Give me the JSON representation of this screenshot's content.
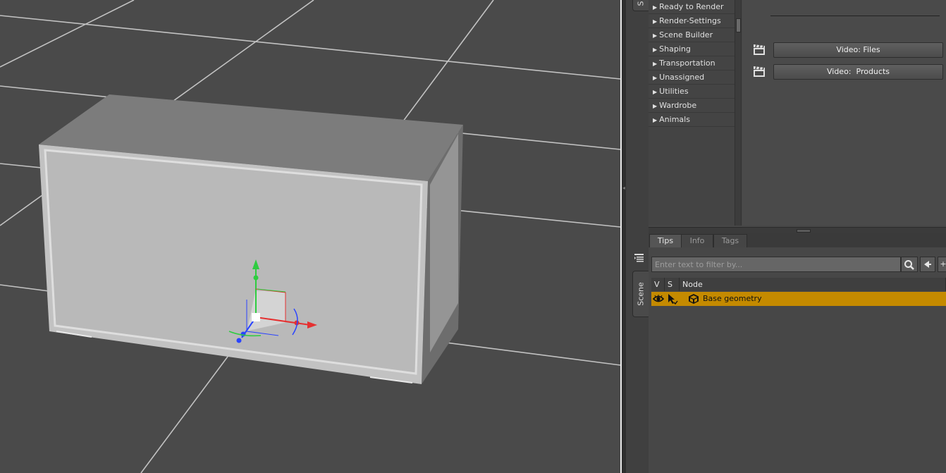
{
  "category_list": {
    "items": [
      "Ready to Render",
      "Render-Settings",
      "Scene Builder",
      "Shaping",
      "Transportation",
      "Unassigned",
      "Utilities",
      "Wardrobe",
      "Animals"
    ]
  },
  "videos": {
    "buttons": [
      "Video: Files",
      "Video:  Products"
    ],
    "icon": "clapperboard-icon"
  },
  "upper_sidebar_tab": "S",
  "lower_sidebar_tab": "Scene",
  "tabs": [
    {
      "label": "Tips",
      "active": true
    },
    {
      "label": "Info",
      "active": false
    },
    {
      "label": "Tags",
      "active": false
    }
  ],
  "scene": {
    "filter_placeholder": "Enter text to filter by...",
    "filter_value": "",
    "columns": [
      "V",
      "S",
      "Node"
    ],
    "rows": [
      {
        "node": "Base geometry",
        "visible_icon": "eye-icon",
        "selectable_icon": "arrow-cursor-icon",
        "type_icon": "geometry-icon",
        "selected": true
      }
    ]
  },
  "colors": {
    "viewport_bg": "#4a4a4a",
    "selection": "#c48a00",
    "panel_bg": "#474747"
  }
}
